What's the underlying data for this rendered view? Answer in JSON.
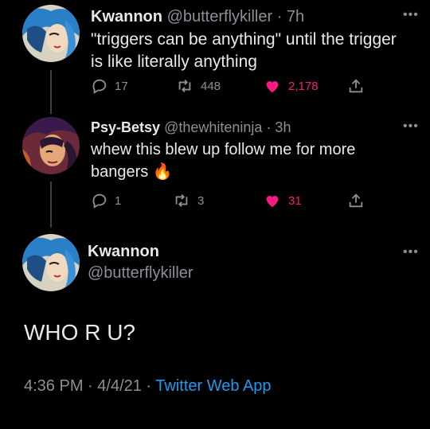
{
  "tweets": [
    {
      "name": "Kwannon",
      "handle": "@butterflykiller",
      "time": "· 7h",
      "text_line1": "\"triggers can be anything\" until the trigger",
      "text_line2": "is like literally anything",
      "replies": "17",
      "retweets": "448",
      "likes": "2,178"
    },
    {
      "name": "Psy-Betsy",
      "handle": "@thewhiteninja",
      "time": "· 3h",
      "text_line1": "whew this blew up follow me for more",
      "text_line2": "bangers",
      "emoji": "🔥",
      "replies": "1",
      "retweets": "3",
      "likes": "31"
    }
  ],
  "main_tweet": {
    "name": "Kwannon",
    "handle": "@butterflykiller",
    "text": "WHO R U?",
    "time": "4:36 PM",
    "sep1": " · ",
    "date": "4/4/21",
    "sep2": " · ",
    "app": "Twitter Web App"
  },
  "icons": {
    "reply": "reply-icon",
    "retweet": "retweet-icon",
    "like": "heart-icon",
    "share": "share-icon",
    "more": "more-icon"
  },
  "colors": {
    "background": "#000000",
    "text": "#e7e9ea",
    "muted": "#8b9096",
    "like": "#f91880",
    "link": "#1d9bf0"
  }
}
